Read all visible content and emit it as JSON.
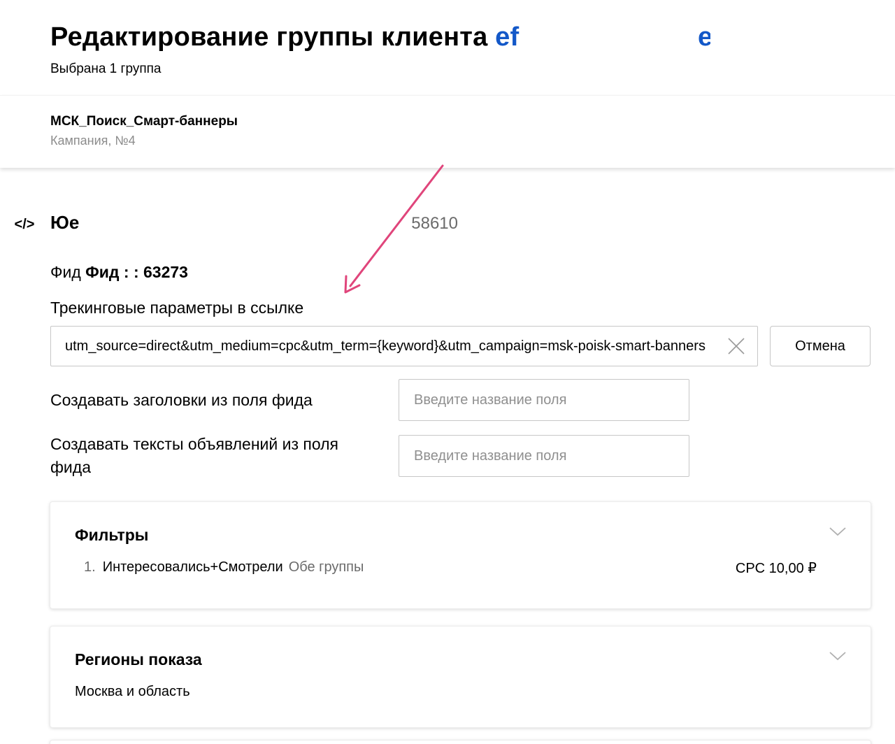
{
  "header": {
    "title": "Редактирование группы клиента ",
    "client_visible": "ef",
    "client_tail": "e",
    "subtitle": "Выбрана 1 группа"
  },
  "campaign": {
    "name": "МСК_Поиск_Смарт-баннеры",
    "number_label": "Кампания, №4"
  },
  "group": {
    "icon": "code-icon",
    "name": "Юе",
    "id_fragment": "58610"
  },
  "feed": {
    "label": "Фид ",
    "value": "Фид : : 63273"
  },
  "tracking": {
    "label": "Трекинговые параметры в ссылке",
    "value": "utm_source=direct&utm_medium=cpc&utm_term={keyword}&utm_campaign=msk-poisk-smart-banners",
    "clear_icon": "close-icon",
    "cancel_label": "Отмена"
  },
  "feed_fields": [
    {
      "label": "Создавать заголовки из поля фида",
      "placeholder": "Введите название поля"
    },
    {
      "label": "Создавать тексты объявлений из поля фида",
      "placeholder": "Введите название поля"
    }
  ],
  "filters_card": {
    "title": "Фильтры",
    "icon": "chevron-down-icon",
    "items": [
      {
        "num": "1.",
        "name": "Интересовались+Смотрели",
        "scope": "Обе группы",
        "cpc": "CPC 10,00 ₽"
      }
    ]
  },
  "regions_card": {
    "title": "Регионы показа",
    "icon": "chevron-down-icon",
    "value": "Москва и область"
  },
  "colors": {
    "client_link": "#1358c8",
    "annotation_arrow": "#e0457b",
    "muted_text": "#6b6b6b",
    "border": "#c7c7c7"
  }
}
